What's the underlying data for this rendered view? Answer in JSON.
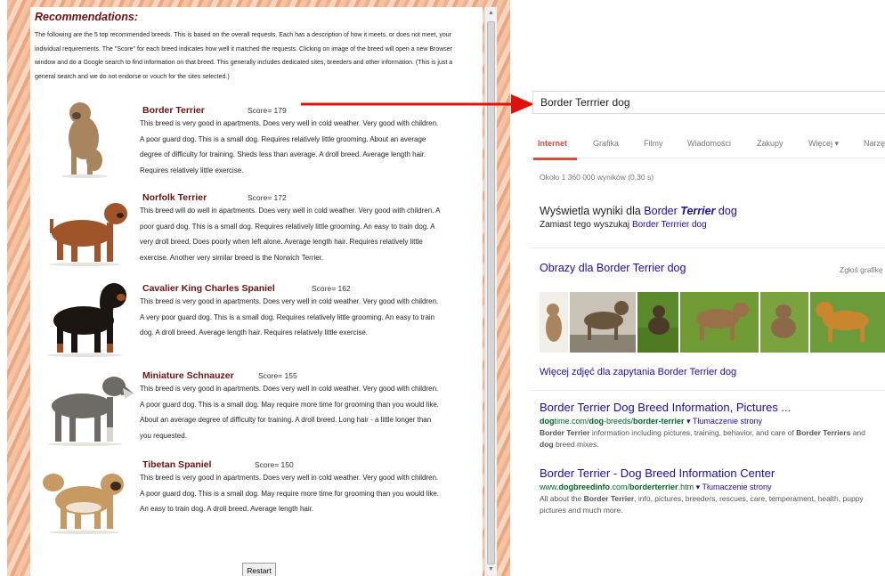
{
  "app": {
    "title": "Recommendations:",
    "intro": "The following are the 5 top recommended breeds. This is based on the overall requests. Each has a description of how it meets, or does not meet, your individual requirements. The \"Score\" for each breed indicates how well it matched the requests. Clicking on image of the breed will open a new Browser window and do a Google search to find information on that breed. This generally includes dedicated sites, breeders and other information. (This is just a general search and we do not endorse or vouch for the sites selected.)",
    "breeds": [
      {
        "name": "Border Terrier",
        "score": "Score= 179",
        "description": "This breed is very good in apartments. Does very well in cold weather. Very good with children. A poor guard dog. This is a small dog. Requires relatively little grooming. About an average degree of difficulty for training. Sheds less than average. A droll breed. Average length hair. Requires relatively little exercise.",
        "coat_color": "#a9855f"
      },
      {
        "name": "Norfolk Terrier",
        "score": "Score= 172",
        "description": "This breed will do well in apartments. Does very well in cold weather. Very good with children. A poor guard dog. This is a small dog. Requires relatively little grooming. An easy to train dog. A very droll breed. Does poorly when left alone. Average length hair. Requires relatively little exercise. Another very similar breed is the Norwich Terrier.",
        "coat_color": "#a0542a"
      },
      {
        "name": "Cavalier King Charles Spaniel",
        "score": "Score= 162",
        "description": "This breed is very good in apartments. Does very well in cold weather. Very good with children. A very poor guard dog. This is a small dog. Requires relatively little grooming. An easy to train dog. A droll breed. Average length hair. Requires relatively little exercise.",
        "coat_color": "#1c1612"
      },
      {
        "name": "Miniature Schnauzer",
        "score": "Score= 155",
        "description": "This breed is very good in apartments. Does very well in cold weather. Very good with children. A poor guard dog. This is a small dog. May require more time for grooming than you would like. About an average degree of difficulty for training. A droll breed. Long hair - a little longer than you requested.",
        "coat_color": "#6e6a66"
      },
      {
        "name": "Tibetan Spaniel",
        "score": "Score= 150",
        "description": "This breed is very good in apartments. Does very well in cold weather. Very good with children. A poor guard dog. This is a small dog. May require more time for grooming than you would like. An easy to train dog. A droll breed. Average length hair.",
        "coat_color": "#c89a63"
      }
    ],
    "restart_label": "Restart"
  },
  "search": {
    "query": "Border Terrrier dog",
    "tabs": [
      "Internet",
      "Grafika",
      "Filmy",
      "Wiadomości",
      "Zakupy",
      "Więcej ▾",
      "Narzę"
    ],
    "active_tab": "Internet",
    "result_stats": "Około 1 360 000 wyników (0,30 s)",
    "showing_prefix": "Wyświetla wyniki dla ",
    "showing_link_1": "Border ",
    "showing_link_bold": "Terrier",
    "showing_link_2": " dog",
    "instead_prefix": "Zamiast tego wyszukaj ",
    "instead_link": "Border Terrrier dog",
    "images_heading": "Obrazy dla Border Terrier dog",
    "report_label": "Zgłoś grafikę",
    "more_images": "Więcej zdjęć dla zapytania Border Terrier dog",
    "results": [
      {
        "title": "Border Terrier Dog Breed Information, Pictures ...",
        "url_1": "dog",
        "url_2": "time.com/",
        "url_3": "dog",
        "url_4": "-breeds/",
        "url_5": "border-terrier",
        "translate": "▾ Tłumaczenie strony",
        "snippet_b1": "Border Terrier",
        "snippet_1": " information including pictures, training, behavior, and care of ",
        "snippet_b2": "Border Terriers",
        "snippet_2": " and ",
        "snippet_b3": "dog",
        "snippet_3": " breed mixes."
      },
      {
        "title": "Border Terrier - Dog Breed Information Center",
        "url_1": "www.",
        "url_2": "dogbreedinfo",
        "url_3": ".com/",
        "url_4": "borderterrier",
        "url_5": ".htm",
        "translate": "▾ Tłumaczenie strony",
        "snippet_1": "All about the ",
        "snippet_b1": "Border Terrier",
        "snippet_2": ", info, pictures, breeders, rescues, care, temperament, health, puppy pictures and much more."
      }
    ],
    "colors": {
      "link": "#1a0dab",
      "url": "#006621",
      "accent": "#dd4b39"
    }
  }
}
